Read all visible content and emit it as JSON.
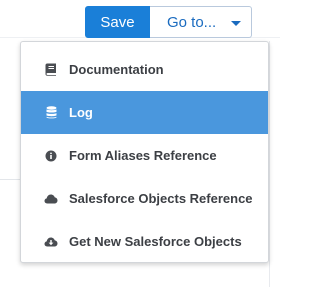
{
  "toolbar": {
    "save_label": "Save",
    "goto_label": "Go to..."
  },
  "menu": {
    "items": [
      {
        "label": "Documentation",
        "icon": "book-icon",
        "active": false
      },
      {
        "label": "Log",
        "icon": "database-icon",
        "active": true
      },
      {
        "label": "Form Aliases Reference",
        "icon": "info-circle-icon",
        "active": false
      },
      {
        "label": "Salesforce Objects Reference",
        "icon": "cloud-icon",
        "active": false
      },
      {
        "label": "Get New Salesforce Objects",
        "icon": "cloud-download-icon",
        "active": false
      }
    ]
  },
  "colors": {
    "primary": "#1a7fd8",
    "active_item": "#4a97dd",
    "text": "#3c3f44",
    "icon": "#4a4d52"
  }
}
